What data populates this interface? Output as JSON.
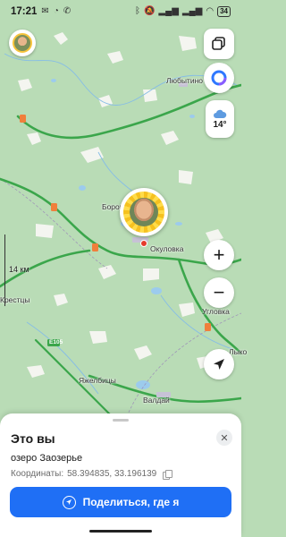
{
  "statusbar": {
    "time": "17:21",
    "battery": "34"
  },
  "map": {
    "scale_label": "14 км",
    "towns": [
      {
        "name": "Любытино"
      },
      {
        "name": "Боровичи"
      },
      {
        "name": "Окуловка"
      },
      {
        "name": "Угловка"
      },
      {
        "name": "Крестцы"
      },
      {
        "name": "Яжелбицы"
      },
      {
        "name": "Валдай"
      },
      {
        "name": "Лыко"
      }
    ],
    "road_badge": "E105"
  },
  "controls": {
    "weather_temp": "14°",
    "zoom_in": "+",
    "zoom_out": "−"
  },
  "sheet": {
    "title": "Это вы",
    "place": "озеро Заозерье",
    "coords_label": "Координаты:",
    "coords_value": "58.394835, 33.196139",
    "share_label": "Поделиться, где я"
  },
  "colors": {
    "primary": "#1f6ff5",
    "forest": "#b9dcb6",
    "road": "#3ba64b",
    "water": "#9ccbed"
  }
}
